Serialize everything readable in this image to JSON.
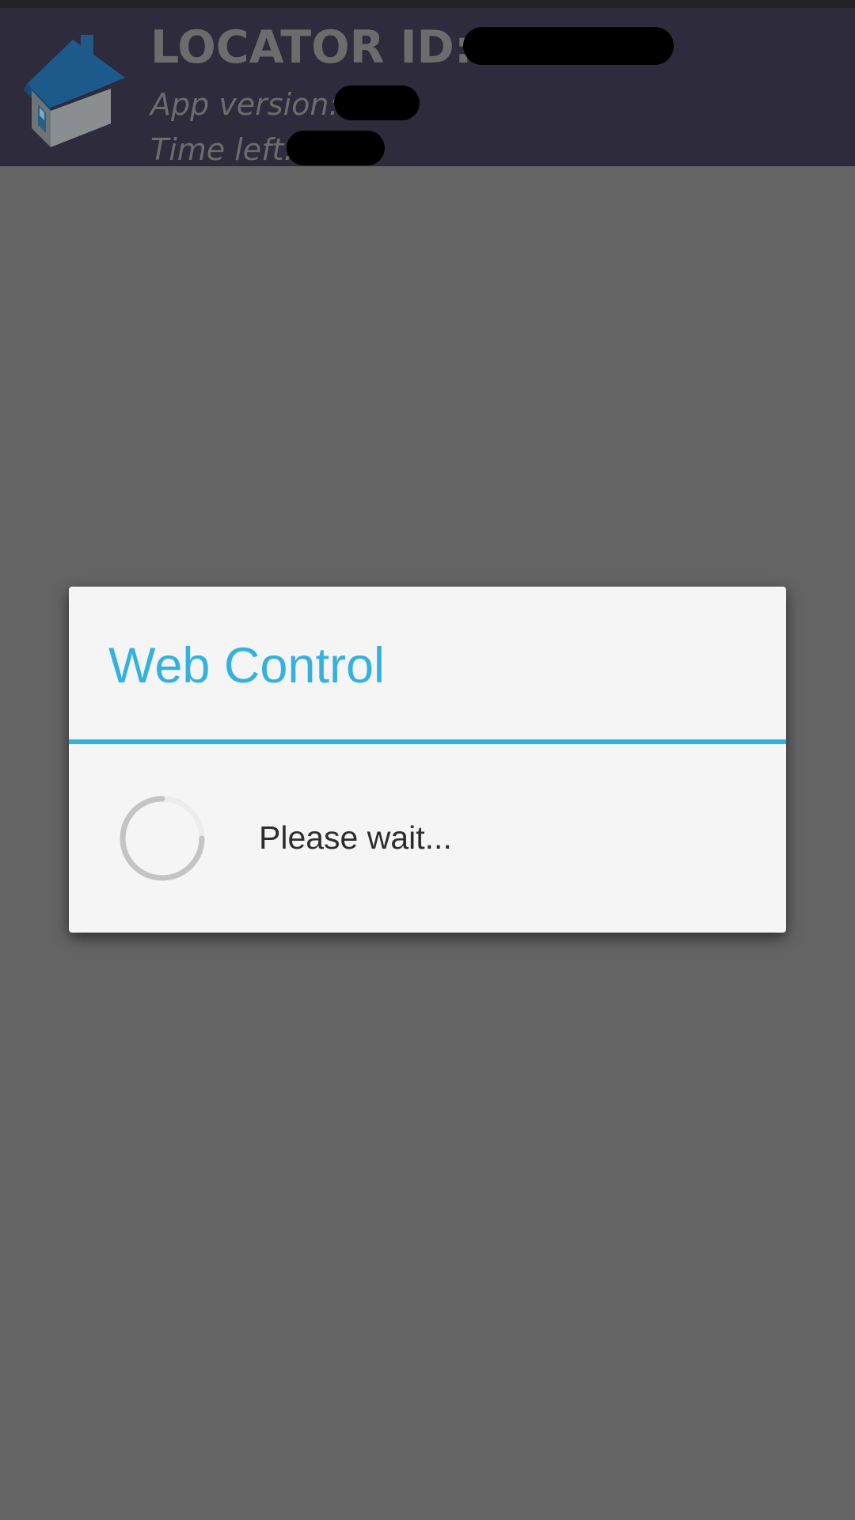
{
  "header": {
    "locator_label": "LOCATOR ID:",
    "locator_value_redacted": true,
    "app_version_label": "App version:",
    "app_version_redacted": true,
    "time_left_label": "Time left:",
    "time_left_redacted": true,
    "icon": "house-icon"
  },
  "dialog": {
    "title": "Web Control",
    "message": "Please wait...",
    "icon": "loading-spinner-icon"
  },
  "colors": {
    "accent": "#35b1e0",
    "header_bg": "#2d2b3c",
    "overlay_bg": "#646464",
    "dialog_bg": "#f5f5f5"
  }
}
